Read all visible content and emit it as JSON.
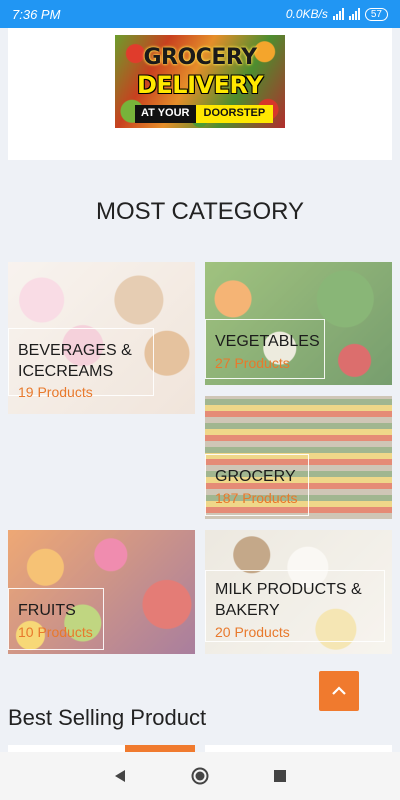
{
  "status_bar": {
    "time": "7:36 PM",
    "net_speed": "0.0KB/s",
    "battery": "57"
  },
  "banner": {
    "line1": "GROCERY",
    "line2": "DELIVERY",
    "tag1": "AT YOUR",
    "tag2": "DOORSTEP"
  },
  "section_title": "MOST CATEGORY",
  "categories": [
    {
      "name": "BEVERAGES & ICECREAMS",
      "count": "19 Products"
    },
    {
      "name": "VEGETABLES",
      "count": "27 Products"
    },
    {
      "name": "GROCERY",
      "count": "187 Products"
    },
    {
      "name": "FRUITS",
      "count": "10 Products"
    },
    {
      "name": "MILK PRODUCTS & BAKERY",
      "count": "20 Products"
    }
  ],
  "best_selling_title": "Best Selling Product",
  "colors": {
    "status_bar": "#2196f3",
    "accent": "#f07a2e",
    "background": "#eef1f6"
  },
  "icons": {
    "scroll_top": "chevron-up-icon",
    "nav_back": "back-triangle-icon",
    "nav_home": "home-circle-icon",
    "nav_recents": "recents-square-icon"
  }
}
